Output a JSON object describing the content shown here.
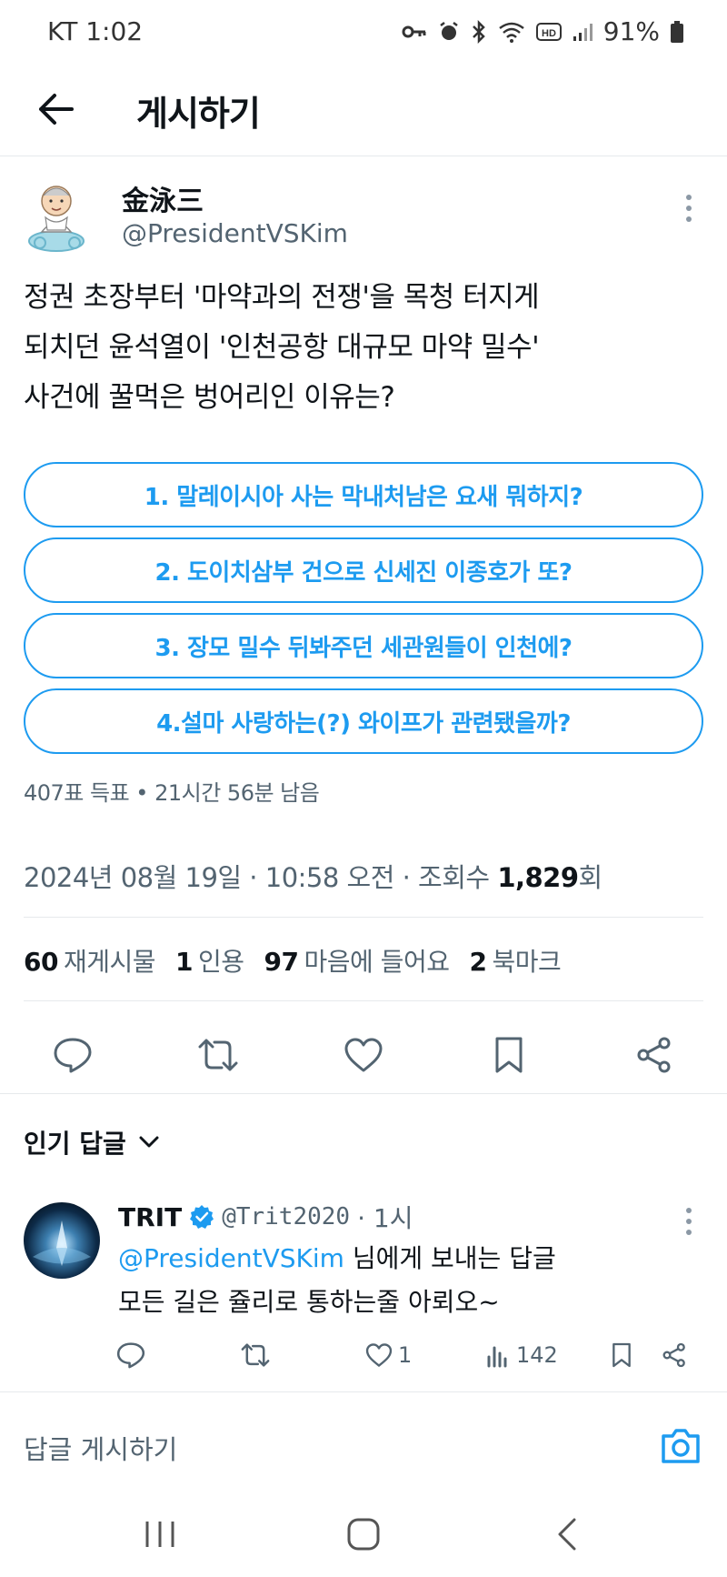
{
  "status_bar": {
    "carrier_time": "KT 1:02",
    "battery": "91%"
  },
  "header": {
    "title": "게시하기"
  },
  "post": {
    "author_name": "金泳三",
    "author_handle": "@PresidentVSKim",
    "text_lines": [
      "정권 초장부터 '마약과의 전쟁'을 목청 터지게",
      "되치던 윤석열이 '인천공항 대규모 마약 밀수'",
      "사건에 꿀먹은 벙어리인 이유는?"
    ],
    "poll": {
      "options": [
        "1. 말레이시아 사는 막내처남은 요새 뭐하지?",
        "2. 도이치삼부 건으로 신세진 이종호가  또?",
        "3. 장모 밀수 뒤봐주던 세관원들이 인천에?",
        "4.설마 사랑하는(?) 와이프가 관련됐을까?"
      ],
      "meta": "407표 득표 • 21시간 56분 남음"
    },
    "timestamp_prefix": "2024년 08월 19일 · 10:58 오전 · 조회수 ",
    "views": "1,829",
    "views_suffix": "회",
    "stats": {
      "reposts_count": "60",
      "reposts_label": "재게시물",
      "quotes_count": "1",
      "quotes_label": "인용",
      "likes_count": "97",
      "likes_label": "마음에 들어요",
      "bookmarks_count": "2",
      "bookmarks_label": "북마크"
    }
  },
  "replies_section": {
    "title": "인기 답글"
  },
  "reply": {
    "name": "TRIT",
    "handle": "@Trit2020",
    "time": "· 1시",
    "mention": "@PresidentVSKim",
    "mention_suffix": " 님에게 보내는 답글",
    "text": "모든 길은 쥴리로 통하는줄 아뢰오~",
    "likes": "1",
    "views": "142"
  },
  "compose": {
    "placeholder": "답글 게시하기"
  },
  "colors": {
    "accent": "#1d9bf0",
    "secondary_text": "#536471",
    "divider": "#e6e9ec"
  }
}
